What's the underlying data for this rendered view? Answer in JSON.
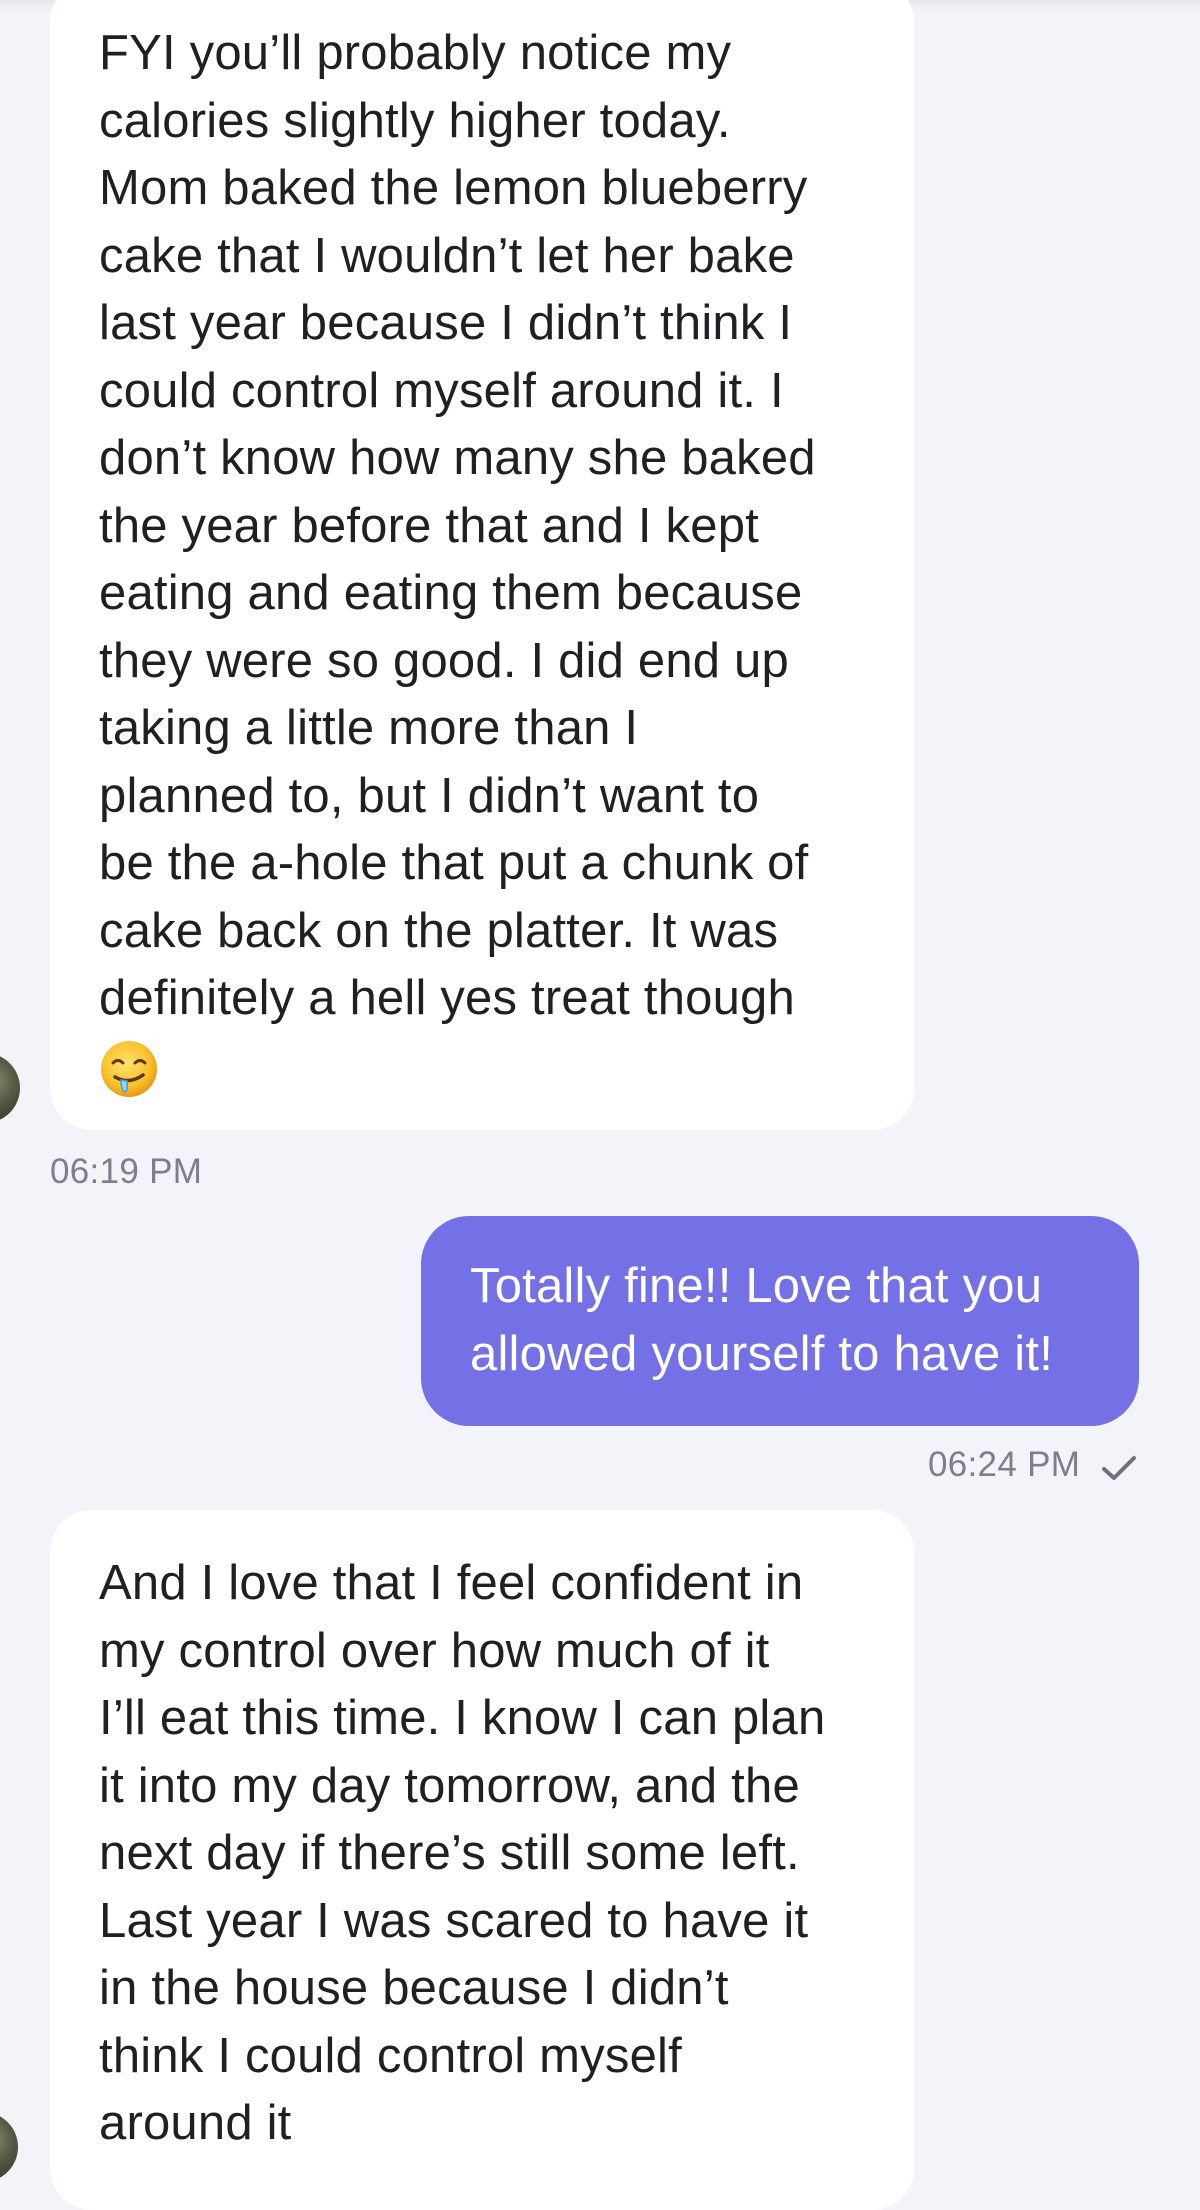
{
  "messages": [
    {
      "direction": "incoming",
      "text": "FYI you’ll probably notice my\ncalories slightly higher today.\nMom baked the lemon blueberry\ncake that I wouldn’t let her bake\nlast year because I didn’t think I\ncould control myself around it. I\ndon’t know how many she baked\nthe year before that and I kept\neating and eating them because\nthey were so good. I did end up\ntaking a little more than I\nplanned to, but I didn’t want to\nbe the a-hole that put a chunk of\ncake back on the platter. It was\ndefinitely a hell yes treat though\n",
      "emoji_icon": "drooling-face-icon",
      "time": "06:19 PM"
    },
    {
      "direction": "outgoing",
      "text": "Totally fine!! Love that you\nallowed yourself to have it!",
      "time": "06:24 PM",
      "status_icon": "checkmark-icon"
    },
    {
      "direction": "incoming",
      "text": "And I love that I feel confident in\nmy control over how much of it\nI’ll eat this time. I know I can plan\nit into my day tomorrow, and the\nnext day if there’s still some left.\nLast year I was scared to have it\nin the house because I didn’t\nthink I could control myself\naround it"
    }
  ],
  "colors": {
    "background": "#f3f4f9",
    "incoming_bubble": "#ffffff",
    "outgoing_bubble": "#7470e6",
    "timestamp": "#7d7f88"
  }
}
